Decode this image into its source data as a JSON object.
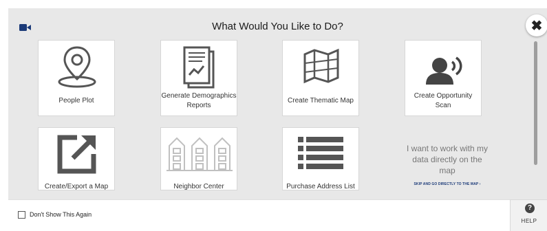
{
  "modal": {
    "title": "What Would You Like to Do?"
  },
  "tiles": [
    {
      "label": "People Plot",
      "icon": "location-pin-icon"
    },
    {
      "label": "Generate Demographics Reports",
      "icon": "report-chart-icon"
    },
    {
      "label": "Create Thematic Map",
      "icon": "folded-map-icon"
    },
    {
      "label": "Create Opportunity Scan",
      "icon": "speaking-person-icon"
    },
    {
      "label": "Create/Export a Map",
      "icon": "export-arrow-icon"
    },
    {
      "label": "Neighbor Center",
      "icon": "buildings-icon"
    },
    {
      "label": "Purchase Address List",
      "icon": "list-icon"
    }
  ],
  "freeform": {
    "text": "I want to work with my data directly on the map",
    "link": "SKIP AND GO DIRECTLY TO THE MAP ›"
  },
  "footer": {
    "checkbox_label": "Don't Show This Again",
    "checked": false
  },
  "help": {
    "label": "HELP",
    "icon": "question-icon"
  },
  "colors": {
    "icon_gray": "#555555",
    "icon_light": "#c0c0c0",
    "link_blue": "#1b3a78",
    "video_icon": "#1b3a78"
  }
}
